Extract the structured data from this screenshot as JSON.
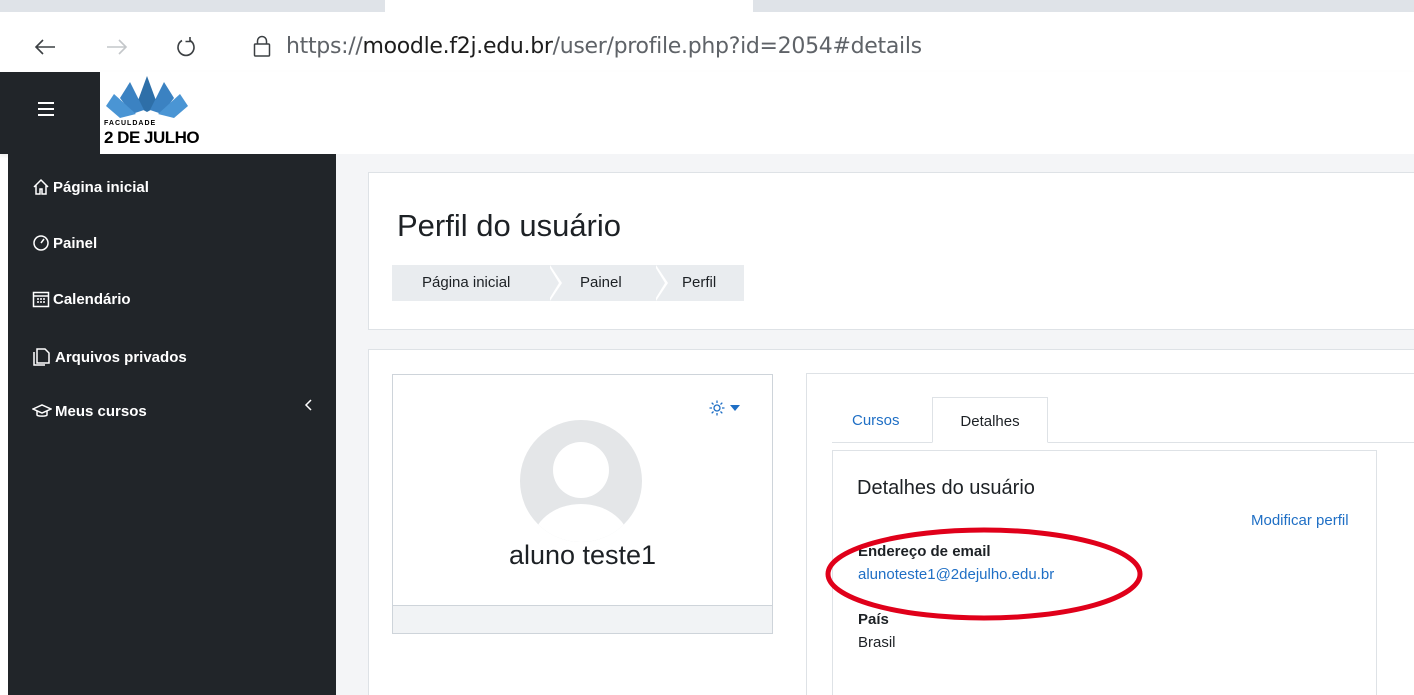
{
  "browser": {
    "url_scheme": "https://",
    "url_host": "moodle.f2j.edu.br",
    "url_path": "/user/profile.php?id=2054#details"
  },
  "logo": {
    "small_text": "FACULDADE",
    "big_text": "2 DE JULHO"
  },
  "sidebar": {
    "items": [
      {
        "label": "Página inicial",
        "icon": "home-icon"
      },
      {
        "label": "Painel",
        "icon": "dashboard-icon"
      },
      {
        "label": "Calendário",
        "icon": "calendar-icon"
      },
      {
        "label": "Arquivos privados",
        "icon": "files-icon"
      },
      {
        "label": "Meus cursos",
        "icon": "graduation-cap-icon"
      }
    ]
  },
  "header": {
    "title": "Perfil do usuário",
    "breadcrumb": [
      "Página inicial",
      "Painel",
      "Perfil"
    ]
  },
  "profile": {
    "name": "aluno teste1"
  },
  "tabs": [
    "Cursos",
    "Detalhes"
  ],
  "details": {
    "title": "Detalhes do usuário",
    "edit_link": "Modificar perfil",
    "email_label": "Endereço de email",
    "email_value": "alunoteste1@2dejulho.edu.br",
    "country_label": "País",
    "country_value": "Brasil"
  },
  "colors": {
    "sidebar": "#212529",
    "link": "#1f6fc5",
    "annotation": "#e0001a",
    "logo_blue": "#2e6fa8"
  }
}
